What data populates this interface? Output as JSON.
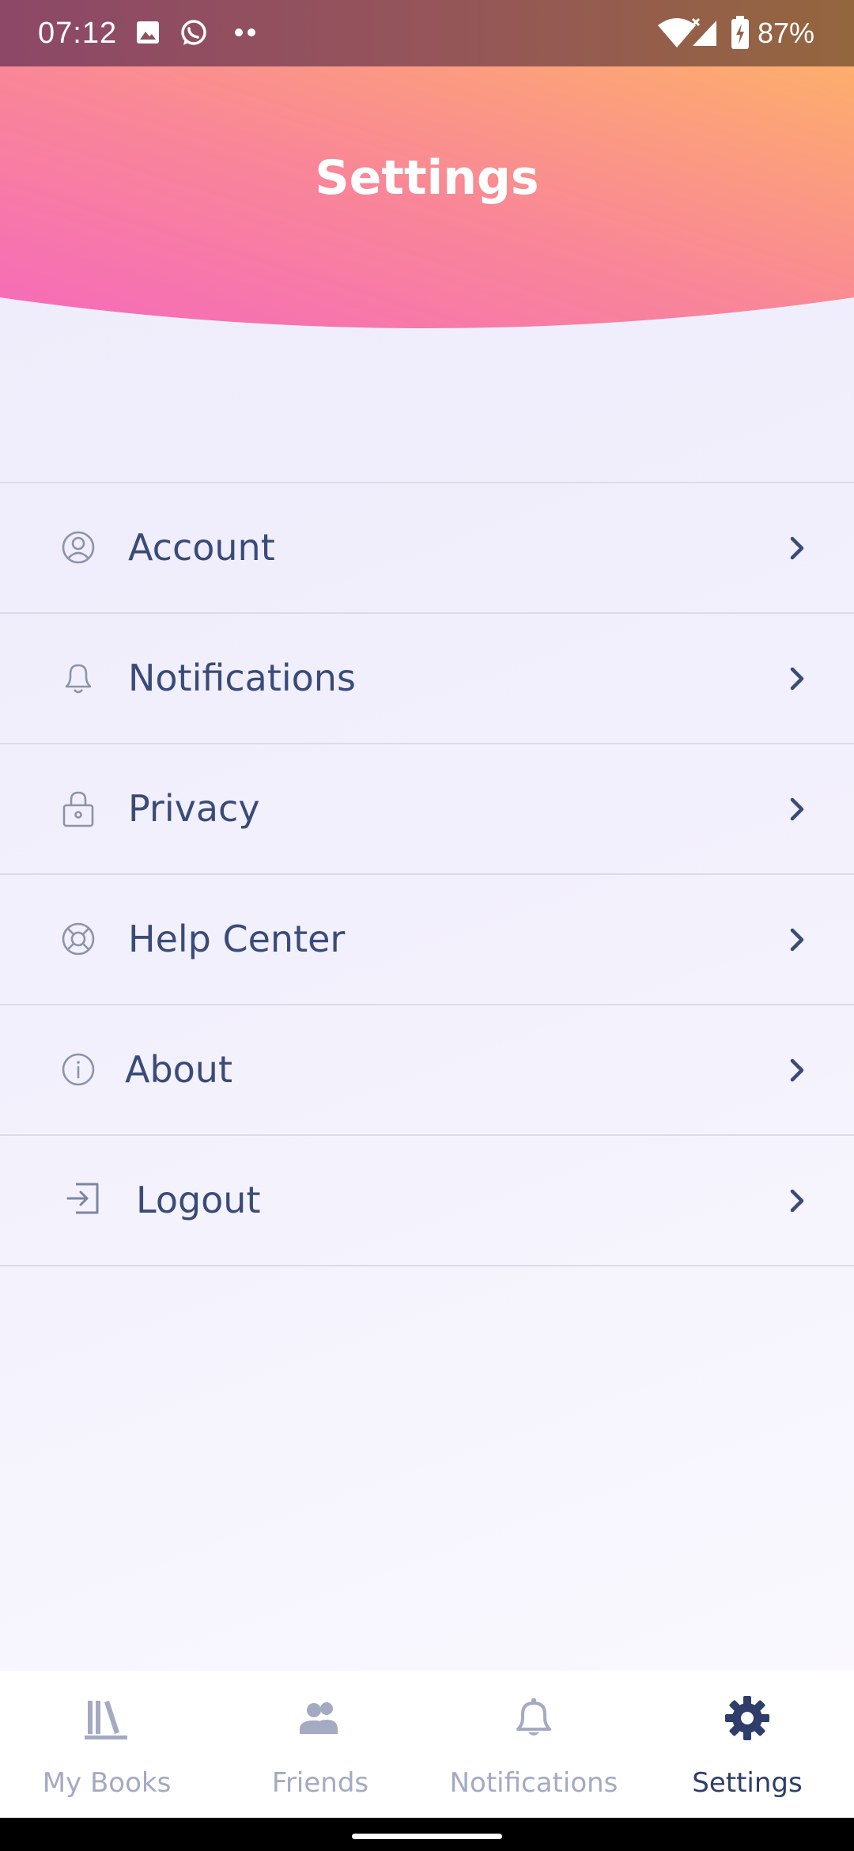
{
  "status_bar": {
    "time": "07:12",
    "battery": "87%",
    "icons": [
      "image-icon",
      "whatsapp-icon",
      "more-dots-icon",
      "wifi-icon",
      "signal-icon",
      "battery-charging-icon"
    ]
  },
  "header": {
    "title": "Settings",
    "gradient_colors": [
      "#f56aba",
      "#f98797",
      "#fdae6c"
    ]
  },
  "menu": {
    "items": [
      {
        "label": "Account",
        "icon": "user-circle-icon"
      },
      {
        "label": "Notifications",
        "icon": "bell-icon"
      },
      {
        "label": "Privacy",
        "icon": "lock-icon"
      },
      {
        "label": "Help Center",
        "icon": "lifebuoy-icon"
      },
      {
        "label": "About",
        "icon": "info-icon"
      },
      {
        "label": "Logout",
        "icon": "logout-icon"
      }
    ]
  },
  "bottom_nav": {
    "tabs": [
      {
        "label": "My Books",
        "icon": "books-icon",
        "active": false
      },
      {
        "label": "Friends",
        "icon": "friends-icon",
        "active": false
      },
      {
        "label": "Notifications",
        "icon": "bell-icon",
        "active": false
      },
      {
        "label": "Settings",
        "icon": "gear-icon",
        "active": true
      }
    ]
  },
  "colors": {
    "text_primary": "#3a4b78",
    "nav_inactive": "#a3aac2",
    "nav_active": "#2f3d6a"
  }
}
